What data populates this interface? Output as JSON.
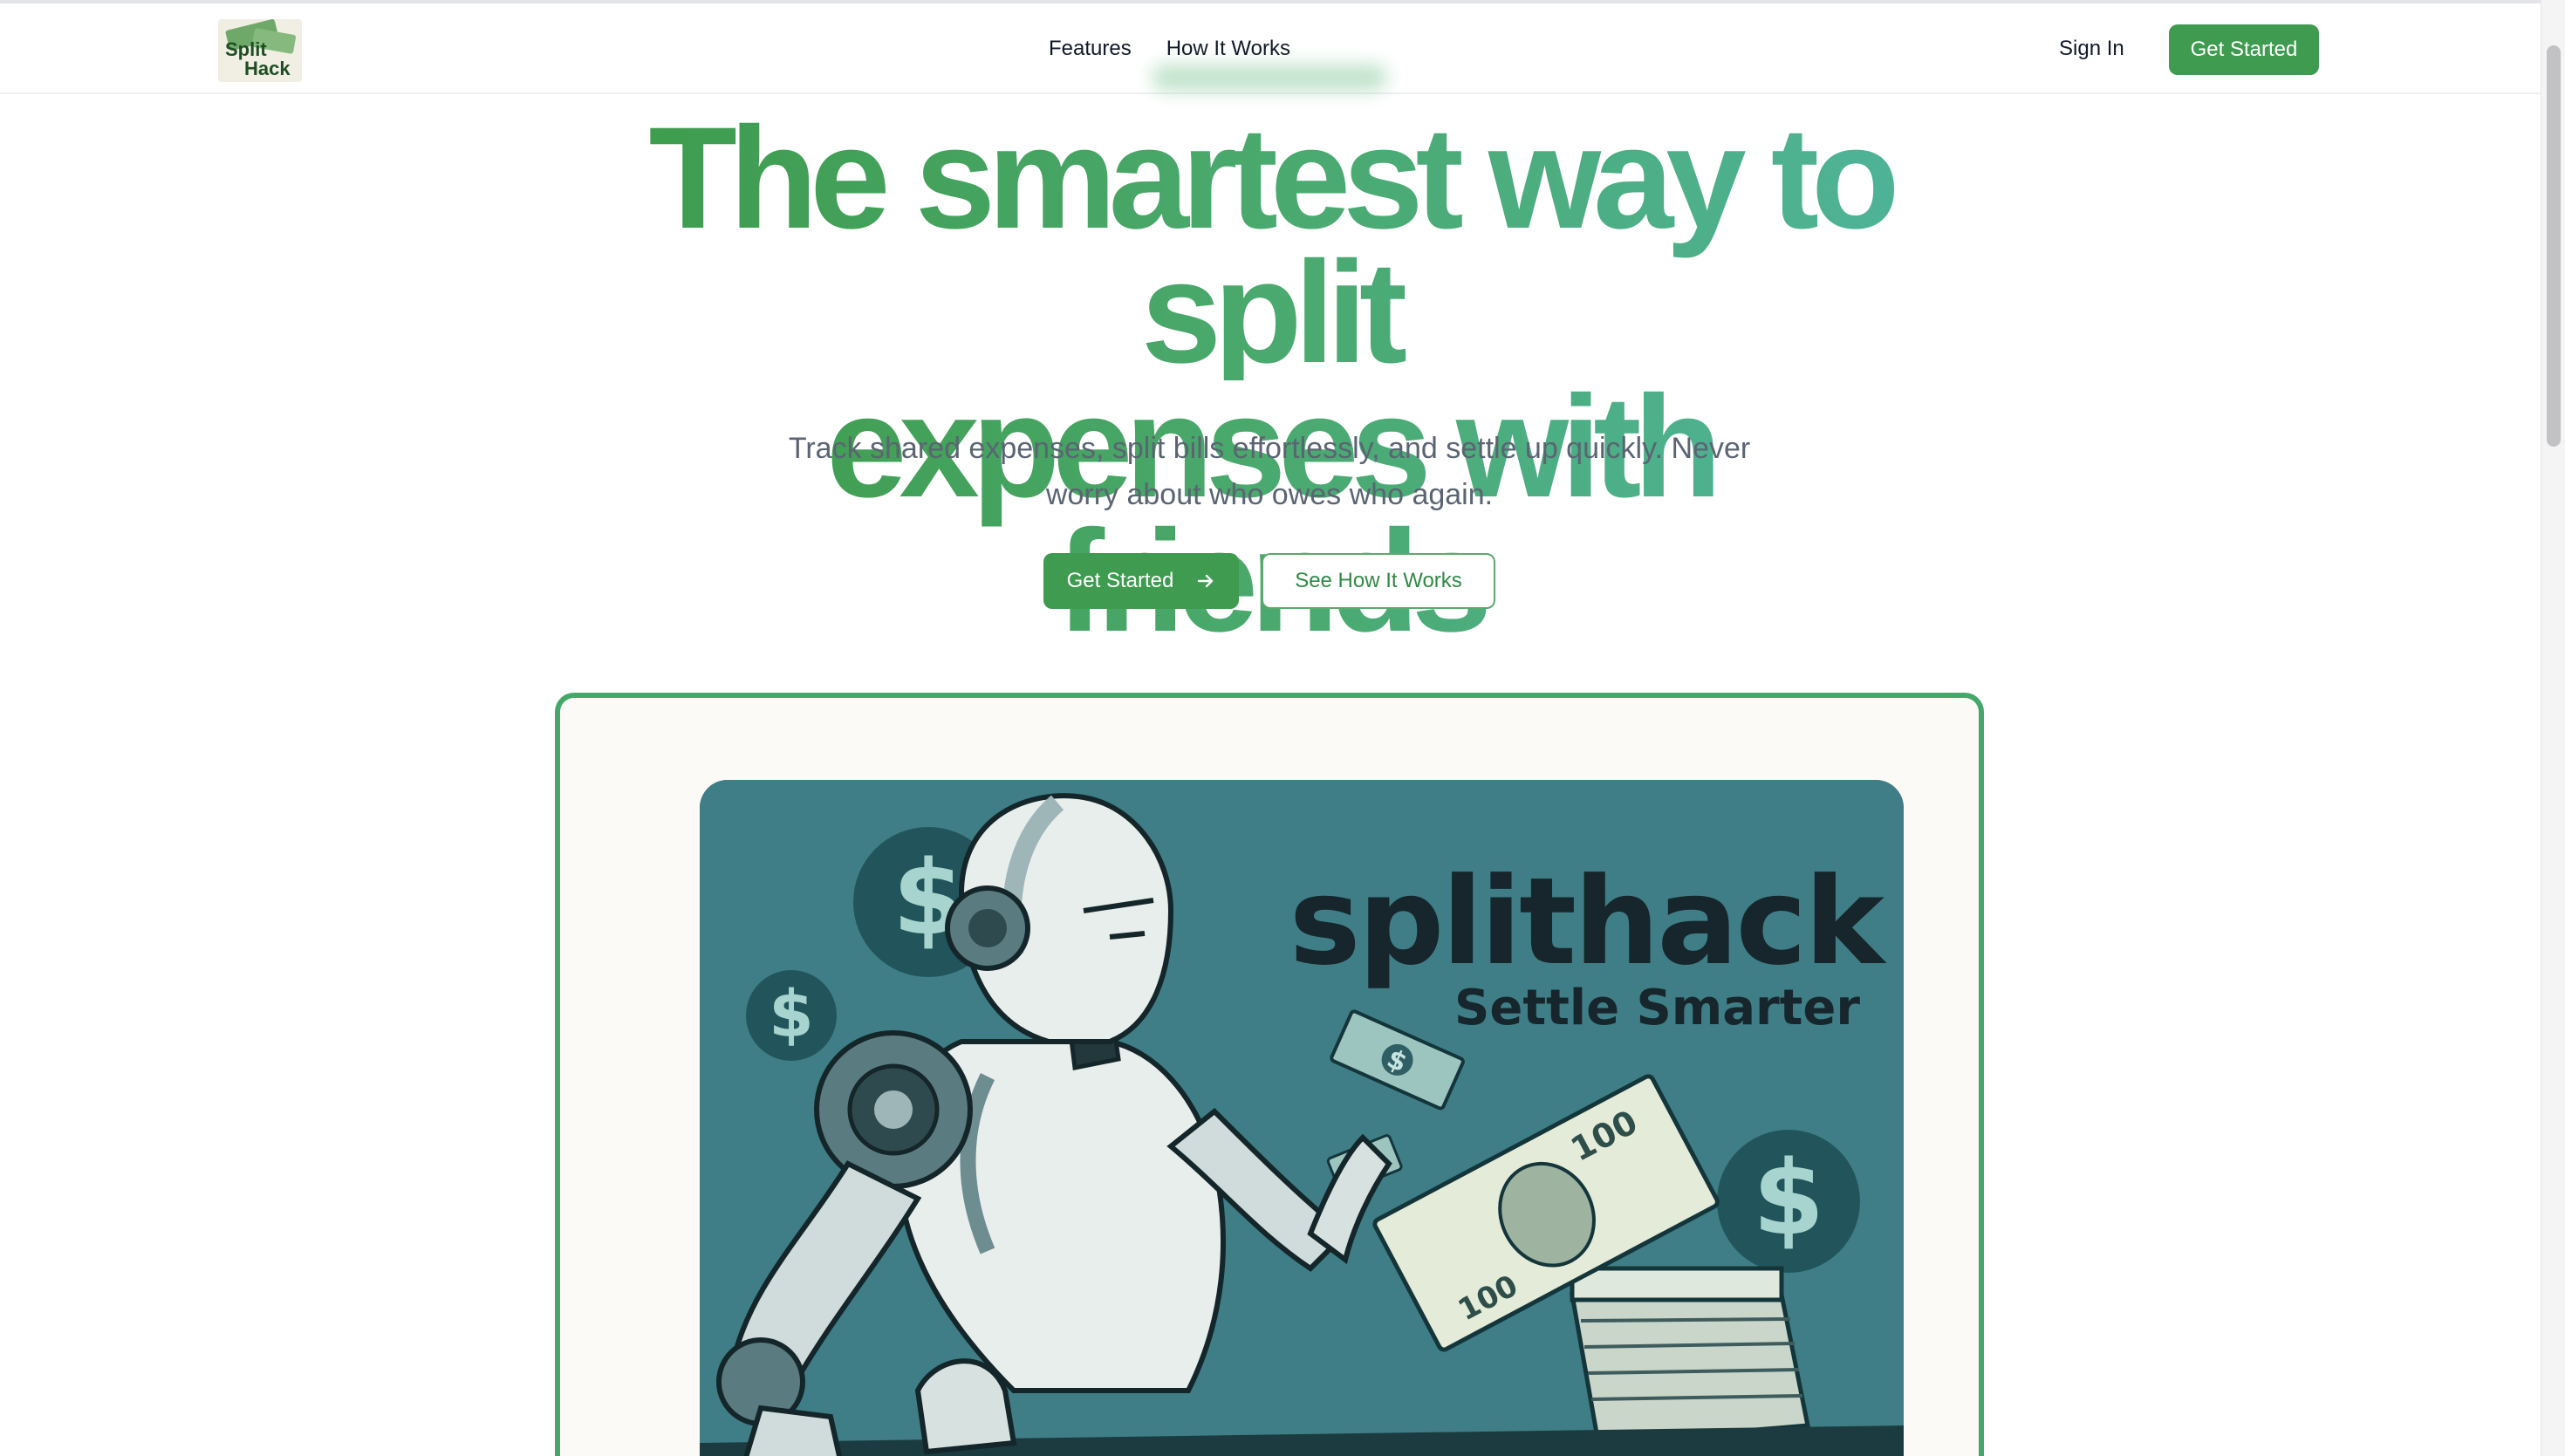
{
  "brand": {
    "logo_text_top": "Split",
    "logo_text_bottom": "Hack"
  },
  "nav": {
    "links": [
      "Features",
      "How It Works"
    ],
    "sign_in": "Sign In",
    "get_started": "Get Started"
  },
  "hero": {
    "title_line1": "The smartest way to split",
    "title_line2": "expenses with friends",
    "subtitle": "Track shared expenses, split bills effortlessly, and settle up quickly. Never worry about who owes who again.",
    "primary_cta": "Get Started",
    "secondary_cta": "See How It Works"
  },
  "illustration": {
    "wordmark": "splithack",
    "tagline": "Settle Smarter",
    "coin_symbol": "$",
    "bill_denomination": "100"
  },
  "colors": {
    "brand_green": "#3e9b4f",
    "gradient_end": "#4fb59f",
    "art_background": "#3f7e86",
    "text_muted": "#5b6472"
  }
}
